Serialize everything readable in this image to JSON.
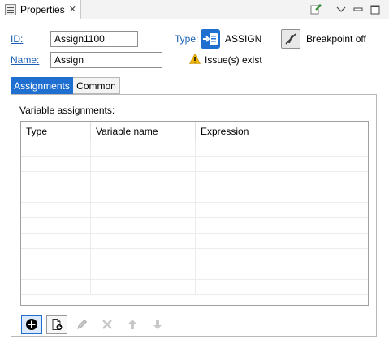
{
  "view": {
    "tab_label": "Properties",
    "close_glyph": "✕",
    "toolbar_icons": [
      "pin-icon",
      "view-menu-icon",
      "minimize-icon",
      "maximize-icon"
    ]
  },
  "header": {
    "id_label": "ID:",
    "id_value": "Assign1100",
    "name_label": "Name:",
    "name_value": "Assign",
    "type_label": "Type:",
    "type_value": "ASSIGN",
    "breakpoint_label": "Breakpoint off",
    "issue_label": "Issue(s) exist"
  },
  "tabs": [
    {
      "label": "Assignments",
      "active": true
    },
    {
      "label": "Common",
      "active": false
    }
  ],
  "assignments": {
    "section_label": "Variable assignments:",
    "columns": [
      "Type",
      "Variable name",
      "Expression"
    ],
    "rows": []
  },
  "toolbar": {
    "buttons": [
      {
        "icon": "add-icon",
        "enabled": true
      },
      {
        "icon": "add-copy-icon",
        "enabled": true
      },
      {
        "icon": "edit-icon",
        "enabled": false
      },
      {
        "icon": "delete-icon",
        "enabled": false
      },
      {
        "icon": "move-up-icon",
        "enabled": false
      },
      {
        "icon": "move-down-icon",
        "enabled": false
      }
    ]
  },
  "colors": {
    "accent": "#1f6fd1",
    "link": "#1a5fb4",
    "warning": "#f0b400"
  }
}
